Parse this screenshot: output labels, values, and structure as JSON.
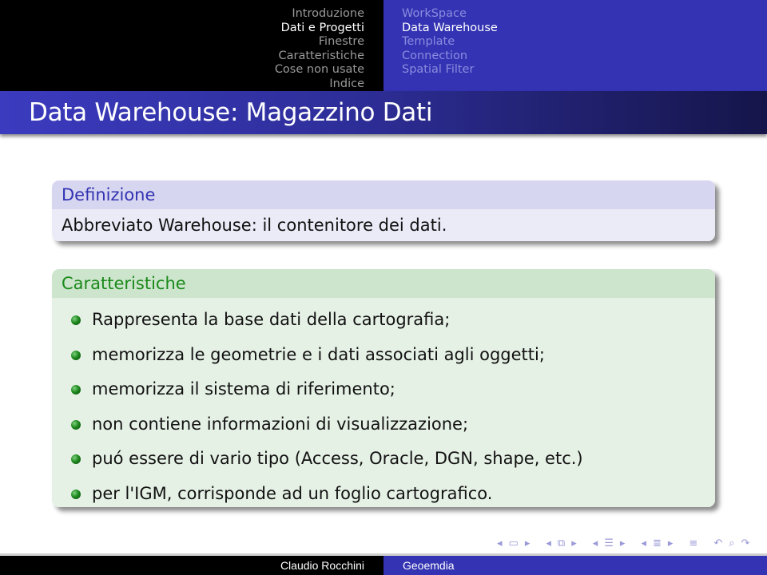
{
  "header": {
    "sections": [
      {
        "label": "Introduzione",
        "active": false
      },
      {
        "label": "Dati e Progetti",
        "active": true
      },
      {
        "label": "Finestre",
        "active": false
      },
      {
        "label": "Caratteristiche",
        "active": false
      },
      {
        "label": "Cose non usate",
        "active": false
      },
      {
        "label": "Indice",
        "active": false
      }
    ],
    "subsections": [
      {
        "label": "WorkSpace",
        "active": false
      },
      {
        "label": "Data Warehouse",
        "active": true
      },
      {
        "label": "Template",
        "active": false
      },
      {
        "label": "Connection",
        "active": false
      },
      {
        "label": "Spatial Filter",
        "active": false
      }
    ]
  },
  "slide": {
    "title": "Data Warehouse: Magazzino Dati",
    "definition_block": {
      "title": "Definizione",
      "body": "Abbreviato Warehouse: il contenitore dei dati."
    },
    "features_block": {
      "title": "Caratteristiche",
      "items": [
        "Rappresenta la base dati della cartografia;",
        "memorizza le geometrie e i dati associati agli oggetti;",
        "memorizza il sistema di riferimento;",
        "non contiene informazioni di visualizzazione;",
        "puó essere di vario tipo (Access, Oracle, DGN, shape, etc.)",
        "per l'IGM, corrisponde ad un foglio cartografico."
      ]
    }
  },
  "navigation_symbols": {
    "slide_prev": "◂",
    "slide_icon": "▭",
    "slide_next": "▸",
    "frame_prev": "◂",
    "frame_icon": "⧉",
    "frame_next": "▸",
    "subsection_prev": "◂",
    "subsection_icon": "☰",
    "subsection_next": "▸",
    "section_prev": "◂",
    "section_icon": "≣",
    "section_next": "▸",
    "document_icon": "≡",
    "back_icon": "↶",
    "search_icon": "⌕",
    "forward_icon": "↷"
  },
  "footer": {
    "author": "Claudio Rocchini",
    "organization": "Geoemdia"
  },
  "colors": {
    "accent_blue": "#3333b3",
    "definition_title": "#3333b3",
    "features_title": "#1a8a1a"
  }
}
